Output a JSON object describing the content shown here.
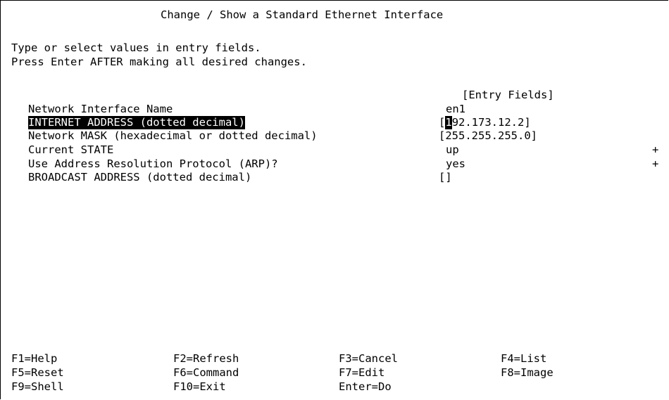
{
  "title": "Change / Show a Standard Ethernet Interface",
  "instructions": [
    "Type or select values in entry fields.",
    "Press Enter AFTER making all desired changes."
  ],
  "entry_fields_header": "[Entry Fields]",
  "fields": [
    {
      "label": "Network Interface Name",
      "value": "en1",
      "list_marker": ""
    },
    {
      "label": "INTERNET ADDRESS (dotted decimal)",
      "value_cursor_char": "1",
      "value_rest": "92.173.12.2",
      "list_marker": ""
    },
    {
      "label": "Network MASK (hexadecimal or dotted decimal)",
      "value": "255.255.255.0",
      "list_marker": ""
    },
    {
      "label": "Current STATE",
      "value": "up",
      "list_marker": "+"
    },
    {
      "label": "Use Address Resolution Protocol (ARP)?",
      "value": "yes",
      "list_marker": "+"
    },
    {
      "label": "BROADCAST ADDRESS (dotted decimal)",
      "value": "",
      "list_marker": ""
    }
  ],
  "bracket_open": "[",
  "bracket_close": "]",
  "function_keys": [
    [
      "F1=Help",
      "F2=Refresh",
      "F3=Cancel",
      "F4=List"
    ],
    [
      "F5=Reset",
      "F6=Command",
      "F7=Edit",
      "F8=Image"
    ],
    [
      "F9=Shell",
      "F10=Exit",
      "Enter=Do"
    ]
  ]
}
